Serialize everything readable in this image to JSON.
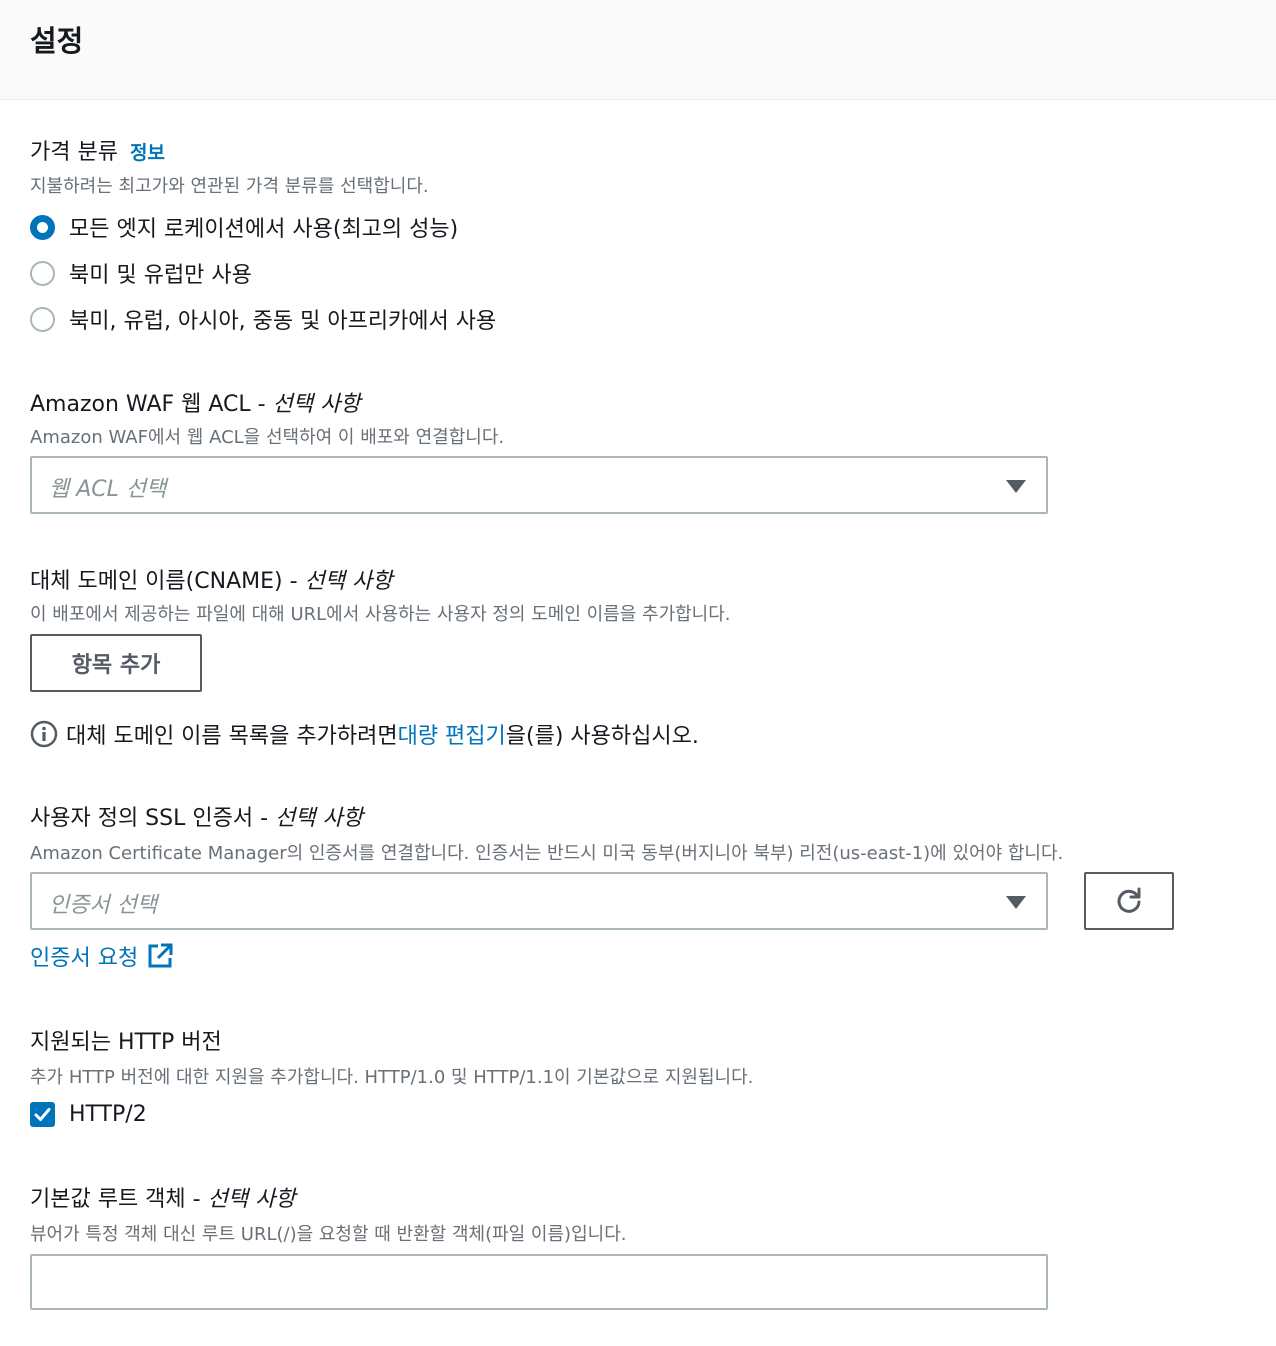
{
  "header": {
    "title": "설정"
  },
  "price_class": {
    "label": "가격 분류",
    "info_link": "정보",
    "description": "지불하려는 최고가와 연관된 가격 분류를 선택합니다.",
    "options": [
      {
        "label": "모든 엣지 로케이션에서 사용(최고의 성능)",
        "selected": true
      },
      {
        "label": "북미 및 유럽만 사용",
        "selected": false
      },
      {
        "label": "북미, 유럽, 아시아, 중동 및 아프리카에서 사용",
        "selected": false
      }
    ]
  },
  "waf": {
    "label": "Amazon WAF 웹 ACL - ",
    "optional": "선택 사항",
    "description": "Amazon WAF에서 웹 ACL을 선택하여 이 배포와 연결합니다.",
    "placeholder": "웹 ACL 선택"
  },
  "cname": {
    "label": "대체 도메인 이름(CNAME) - ",
    "optional": "선택 사항",
    "description": "이 배포에서 제공하는 파일에 대해 URL에서 사용하는 사용자 정의 도메인 이름을 추가합니다.",
    "add_button": "항목 추가",
    "note_before": "대체 도메인 이름 목록을 추가하려면 ",
    "note_link": "대량 편집기",
    "note_after": "을(를) 사용하십시오."
  },
  "ssl": {
    "label": "사용자 정의 SSL 인증서 - ",
    "optional": "선택 사항",
    "description": "Amazon Certificate Manager의 인증서를 연결합니다. 인증서는 반드시 미국 동부(버지니아 북부) 리전(us-east-1)에 있어야 합니다.",
    "placeholder": "인증서 선택",
    "request_link": "인증서 요청"
  },
  "http": {
    "label": "지원되는 HTTP 버전",
    "description": "추가 HTTP 버전에 대한 지원을 추가합니다. HTTP/1.0 및 HTTP/1.1이 기본값으로 지원됩니다.",
    "option": "HTTP/2",
    "checked": true
  },
  "root_object": {
    "label": "기본값 루트 객체 - ",
    "optional": "선택 사항",
    "description": "뷰어가 특정 객체 대신 루트 URL(/)을 요청할 때 반환할 객체(파일 이름)입니다.",
    "value": ""
  },
  "colors": {
    "accent": "#0073bb",
    "text": "#16191f",
    "muted": "#687078",
    "border": "#aab7b8"
  },
  "icons": [
    "info-icon",
    "refresh-icon",
    "external-link-icon",
    "check-icon",
    "caret-down-icon"
  ]
}
